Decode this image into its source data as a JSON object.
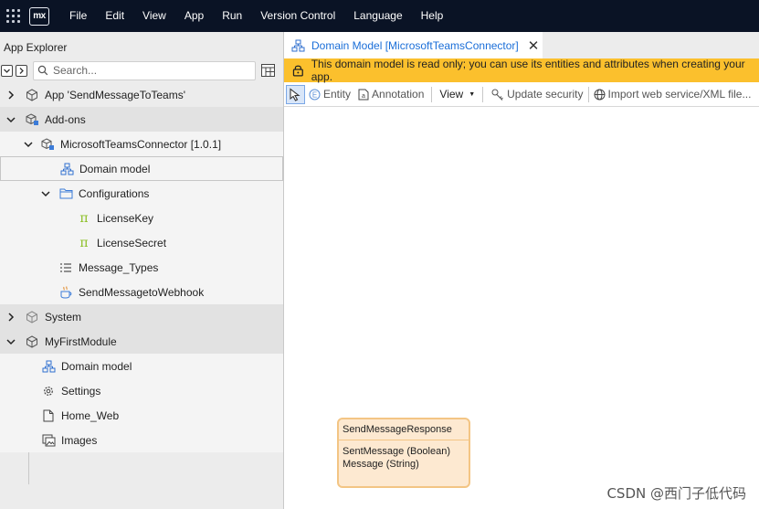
{
  "menubar": {
    "logo_text": "mx",
    "items": [
      "File",
      "Edit",
      "View",
      "App",
      "Run",
      "Version Control",
      "Language",
      "Help"
    ]
  },
  "explorer": {
    "title": "App Explorer",
    "search_placeholder": "Search...",
    "tree": [
      {
        "label": "App 'SendMessageToTeams'",
        "icon": "cube-icon",
        "expanded": false
      },
      {
        "label": "Add-ons",
        "icon": "addon-cube-icon",
        "expanded": true
      },
      {
        "label": "MicrosoftTeamsConnector [1.0.1]",
        "icon": "addon-cube-icon",
        "expanded": true
      },
      {
        "label": "Domain model",
        "icon": "domain-model-icon",
        "selected": true
      },
      {
        "label": "Configurations",
        "icon": "folder-icon",
        "expanded": true
      },
      {
        "label": "LicenseKey",
        "icon": "constant-pi-icon"
      },
      {
        "label": "LicenseSecret",
        "icon": "constant-pi-icon"
      },
      {
        "label": "Message_Types",
        "icon": "enumeration-icon"
      },
      {
        "label": "SendMessagetoWebhook",
        "icon": "java-action-icon"
      },
      {
        "label": "System",
        "icon": "cube-icon",
        "expanded": false
      },
      {
        "label": "MyFirstModule",
        "icon": "cube-icon",
        "expanded": true
      },
      {
        "label": "Domain model",
        "icon": "domain-model-icon"
      },
      {
        "label": "Settings",
        "icon": "gear-icon"
      },
      {
        "label": "Home_Web",
        "icon": "page-icon"
      },
      {
        "label": "Images",
        "icon": "images-icon"
      }
    ]
  },
  "editor": {
    "tab_title": "Domain Model [MicrosoftTeamsConnector]",
    "banner": "This domain model is read only; you can use its entities and attributes when creating your app.",
    "toolbar": {
      "entity": "Entity",
      "annotation": "Annotation",
      "view": "View",
      "update_security": "Update security",
      "import_service": "Import web service/XML file..."
    },
    "entity": {
      "name": "SendMessageResponse",
      "attributes": [
        "SentMessage (Boolean)",
        "Message (String)"
      ]
    }
  },
  "watermark": "CSDN @西门子低代码",
  "colors": {
    "menubar_bg": "#0a1325",
    "banner_bg": "#fbc02d",
    "tab_text": "#1a6ed8",
    "entity_fill": "#fde9d1",
    "entity_border": "#f3c584",
    "pi_green": "#8cbf26"
  }
}
